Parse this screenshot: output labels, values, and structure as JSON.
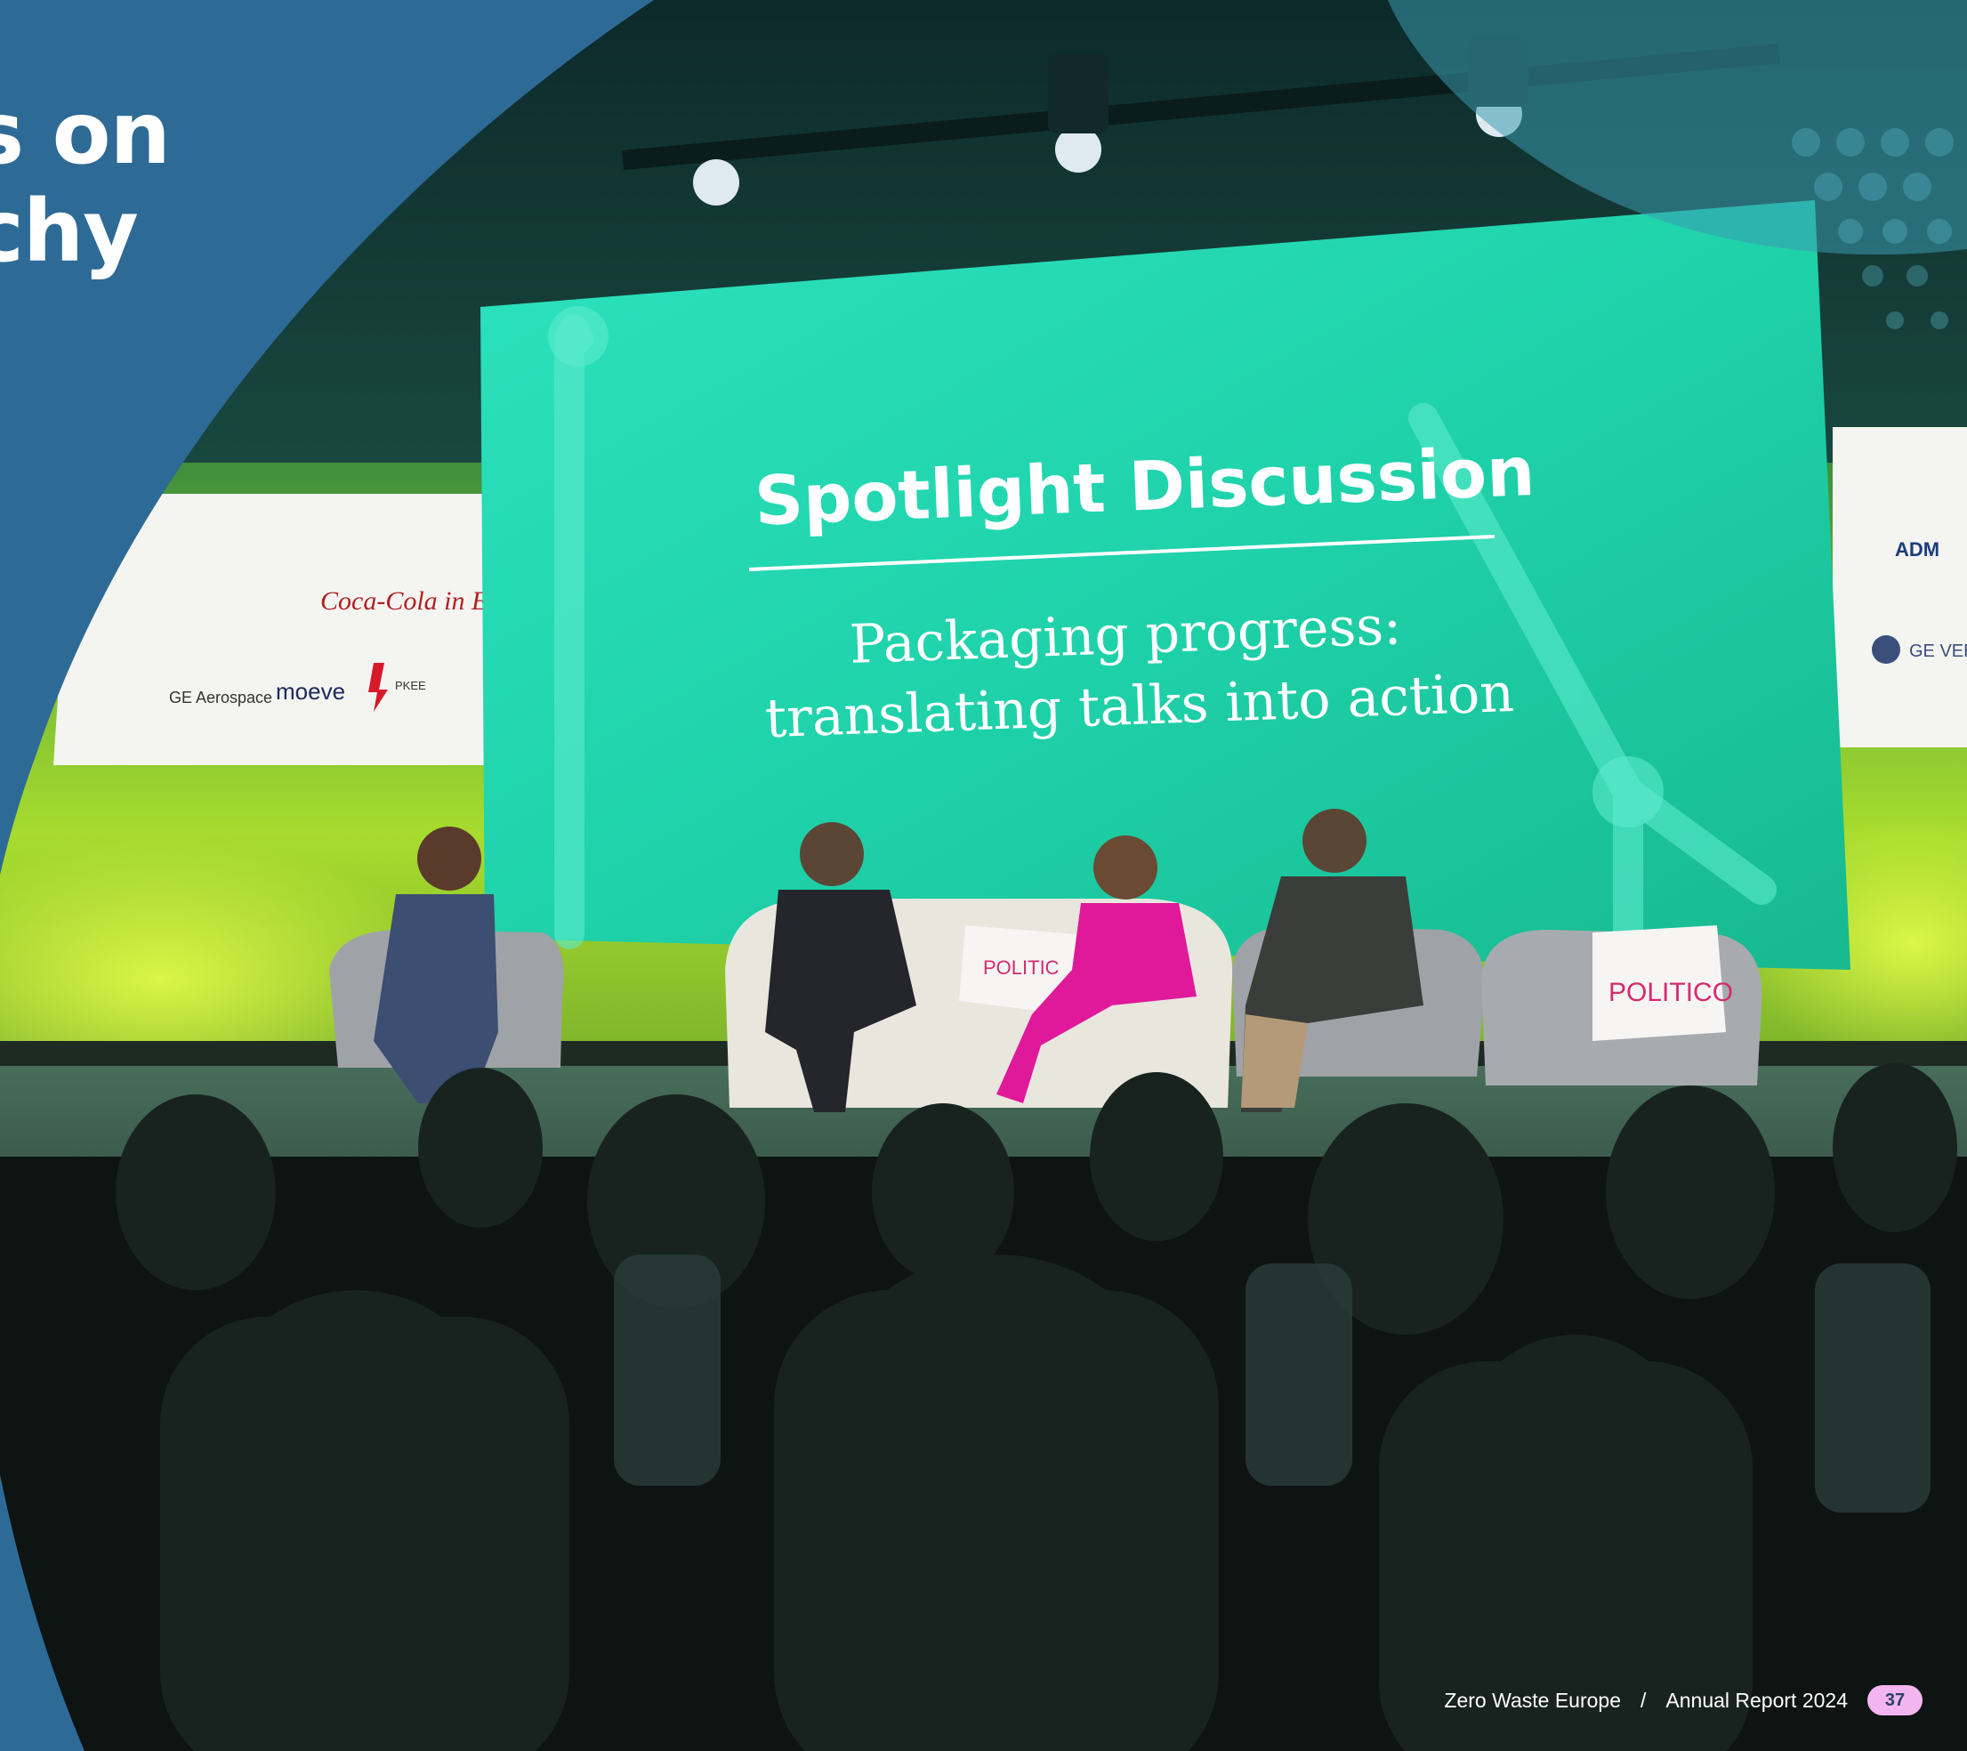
{
  "page": {
    "heading_lines": [
      "s on",
      "chy"
    ],
    "footer": {
      "org": "Zero Waste Europe",
      "separator": "/",
      "report": "Annual Report 2024",
      "page_number": "37"
    }
  },
  "photo": {
    "screen_title": "Spotlight Discussion",
    "screen_subtitle_line1": "Packaging progress:",
    "screen_subtitle_line2": "translating talks into action",
    "sponsor_logos_left": [
      "Coca-Cola in Europe",
      "GE Aerospace",
      "moeve",
      "PKEE"
    ],
    "sponsor_logos_right": [
      "ADM",
      "GE VER"
    ],
    "cushion_text_left": "POLITIC",
    "cushion_text_right": "POLITICO"
  },
  "colors": {
    "page_blue": "#2e6a96",
    "screen_green": "#1fd6ad",
    "stage_green": "#9fd635",
    "badge_pink": "#f3b5ef",
    "accent_magenta": "#e0199a"
  }
}
